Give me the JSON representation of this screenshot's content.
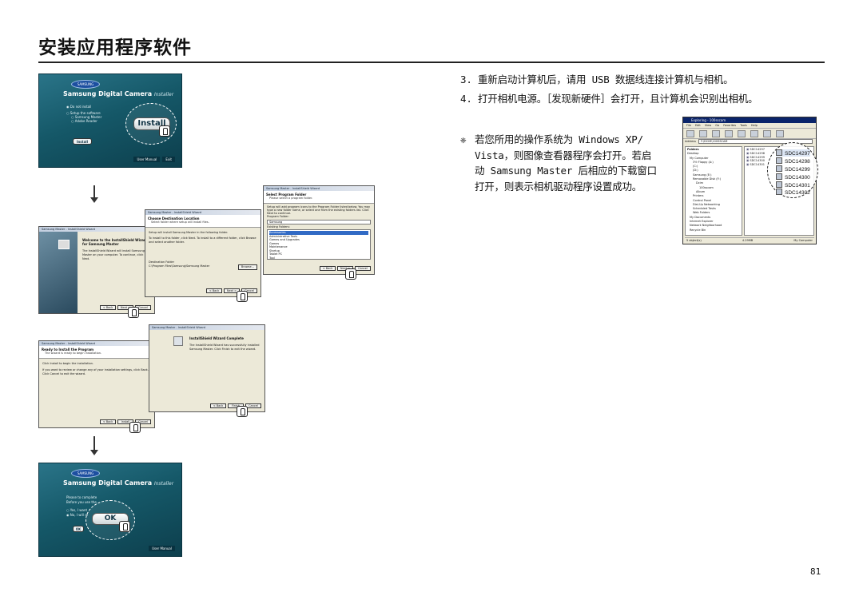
{
  "page_title": "安装应用程序软件",
  "page_number": "81",
  "installer_top": {
    "logo": "SAMSUNG",
    "title_main": "Samsung Digital Camera",
    "title_sub": "Installer",
    "options": [
      "Do not install",
      "Setup the software",
      "Samsung Master",
      "Adobe Reader"
    ],
    "big_button": "Install",
    "small_button": "Install",
    "footer": [
      "User Manual",
      "Exit"
    ]
  },
  "wizard_welcome": {
    "titlebar": "Samsung Master - InstallShield Wizard",
    "heading": "Welcome to the InstallShield Wizard for Samsung Master",
    "body": "The InstallShield Wizard will install Samsung Master on your computer. To continue, click Next.",
    "buttons": [
      "< Back",
      "Next >",
      "Cancel"
    ]
  },
  "wizard_destination": {
    "titlebar": "Samsung Master - InstallShield Wizard",
    "heading": "Choose Destination Location",
    "subheading": "Select folder where setup will install files.",
    "body1": "Setup will install Samsung Master in the following folder.",
    "body2": "To install to this folder, click Next. To install to a different folder, click Browse and select another folder.",
    "folder_label": "Destination Folder",
    "folder_path": "C:\\Program Files\\Samsung\\Samsung Master",
    "browse": "Browse...",
    "buttons": [
      "< Back",
      "Next >",
      "Cancel"
    ]
  },
  "wizard_program_folder": {
    "titlebar": "Samsung Master - InstallShield Wizard",
    "heading": "Select Program Folder",
    "subheading": "Please select a program folder.",
    "body": "Setup will add program icons to the Program Folder listed below. You may type a new folder name, or select one from the existing folders list. Click Next to continue.",
    "program_folder_label": "Program Folder:",
    "program_folder_value": "Samsung",
    "existing_label": "Existing Folders:",
    "existing": [
      "Accessories",
      "Administrative Tools",
      "Games and Upgrades",
      "Games",
      "Maintenance",
      "Startup",
      "Tablet PC",
      "Tool"
    ],
    "buttons": [
      "< Back",
      "Next >",
      "Cancel"
    ]
  },
  "wizard_ready": {
    "titlebar": "Samsung Master - InstallShield Wizard",
    "heading": "Ready to Install the Program",
    "subheading": "The wizard is ready to begin installation.",
    "body1": "Click Install to begin the installation.",
    "body2": "If you want to review or change any of your installation settings, click Back. Click Cancel to exit the wizard.",
    "buttons": [
      "< Back",
      "Install",
      "Cancel"
    ]
  },
  "wizard_complete": {
    "titlebar": "Samsung Master - InstallShield Wizard",
    "heading": "InstallShield Wizard Complete",
    "body": "The InstallShield Wizard has successfully installed Samsung Master. Click Finish to exit the wizard.",
    "buttons": [
      "< Back",
      "Finish",
      "Cancel"
    ]
  },
  "installer_bottom": {
    "logo": "SAMSUNG",
    "title_main": "Samsung Digital Camera",
    "title_sub": "Installer",
    "line1": "Please to complete",
    "line2": "Before you use the",
    "options": [
      "Yes, I want",
      "No, I will re"
    ],
    "big_button": "OK",
    "small_button": "OK",
    "footer": [
      "User Manual"
    ]
  },
  "steps": [
    "3. 重新启动计算机后，请用 USB 数据线连接计算机与相机。",
    "4. 打开相机电源。［发现新硬件］会打开，且计算机会识别出相机。"
  ],
  "note": {
    "mark": "❈",
    "line1": "若您所用的操作系统为 Windows XP/",
    "line2": "Vista，则图像查看器程序会打开。若启",
    "line3": "动 Samsung Master 后相应的下载窗口",
    "line4": "打开，则表示相机驱动程序设置成功。"
  },
  "explorer": {
    "titlebar": "Exploring - 100sscam",
    "menu": "File Edit View Go Favorites Tools Help",
    "address_label": "Address",
    "address_value": "F:\\DCIM\\100SSCAM",
    "folders_label": "Folders",
    "tree": [
      "Desktop",
      "My Computer",
      "3½ Floppy (A:)",
      "(C:)",
      "(D:)",
      "Samsung (E:)",
      "Removable Disk (F:)",
      "Dcim",
      "100sscam",
      "Album",
      "Printers",
      "Control Panel",
      "Dial-Up Networking",
      "Scheduled Tasks",
      "Web Folders",
      "My Documents",
      "Internet Explorer",
      "Network Neighborhood",
      "Recycle Bin"
    ],
    "files": [
      "SDC14297",
      "SDC14298",
      "SDC14299",
      "SDC14300",
      "SDC14301"
    ],
    "status_left": "5 object(s)",
    "status_mid": "4.29MB",
    "status_right": "My Computer",
    "callout_files": [
      "SDC14297",
      "SDC14298",
      "SDC14299",
      "SDC14300",
      "SDC14301",
      "SDC14302"
    ]
  }
}
